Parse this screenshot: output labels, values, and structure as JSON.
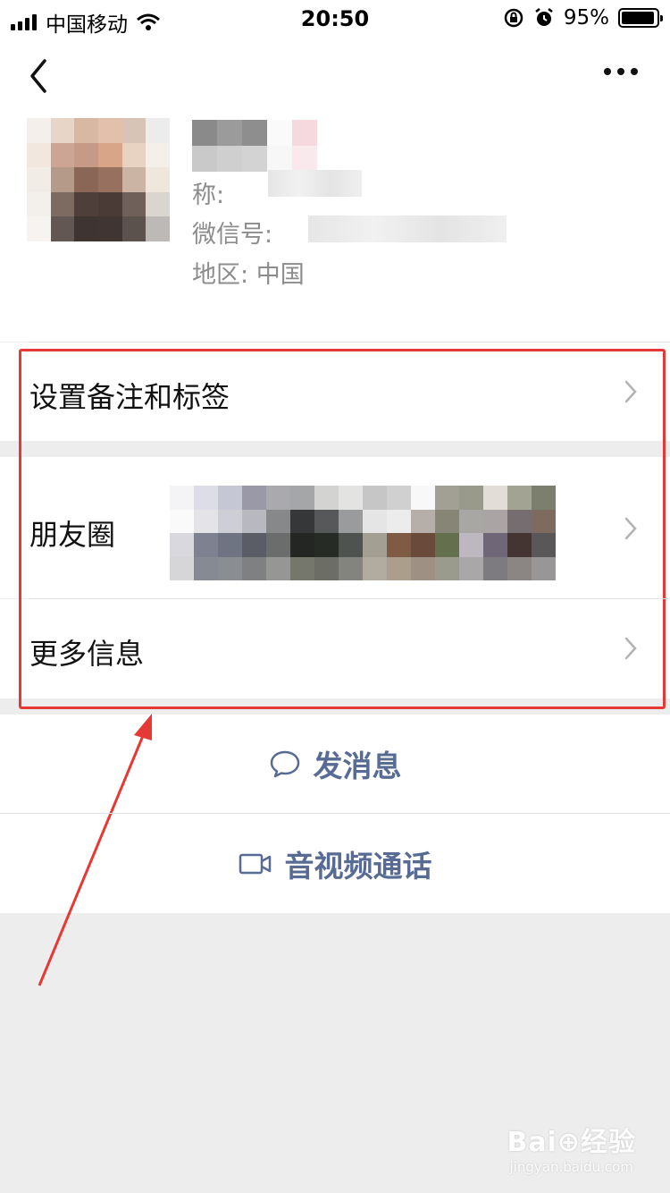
{
  "status_bar": {
    "carrier": "中国移动",
    "time": "20:50",
    "battery_percent": "95%",
    "battery_level": 0.95
  },
  "nav": {
    "back_icon": "chevron-left-icon",
    "more_icon": "more-dots-icon"
  },
  "profile": {
    "nickname_label": "称:",
    "wechat_id_label": "微信号:",
    "region_label": "地区:",
    "region_value": "中国"
  },
  "rows": {
    "remark_tags": "设置备注和标签",
    "moments": "朋友圈",
    "more_info": "更多信息"
  },
  "actions": {
    "message": "发消息",
    "video_call": "音视频通话"
  },
  "watermark": {
    "brand": "Bai⊕经验",
    "url": "jingyan.baidu.com"
  },
  "colors": {
    "link_blue": "#576b95",
    "highlight_red": "#e53935",
    "background": "#ededed"
  }
}
